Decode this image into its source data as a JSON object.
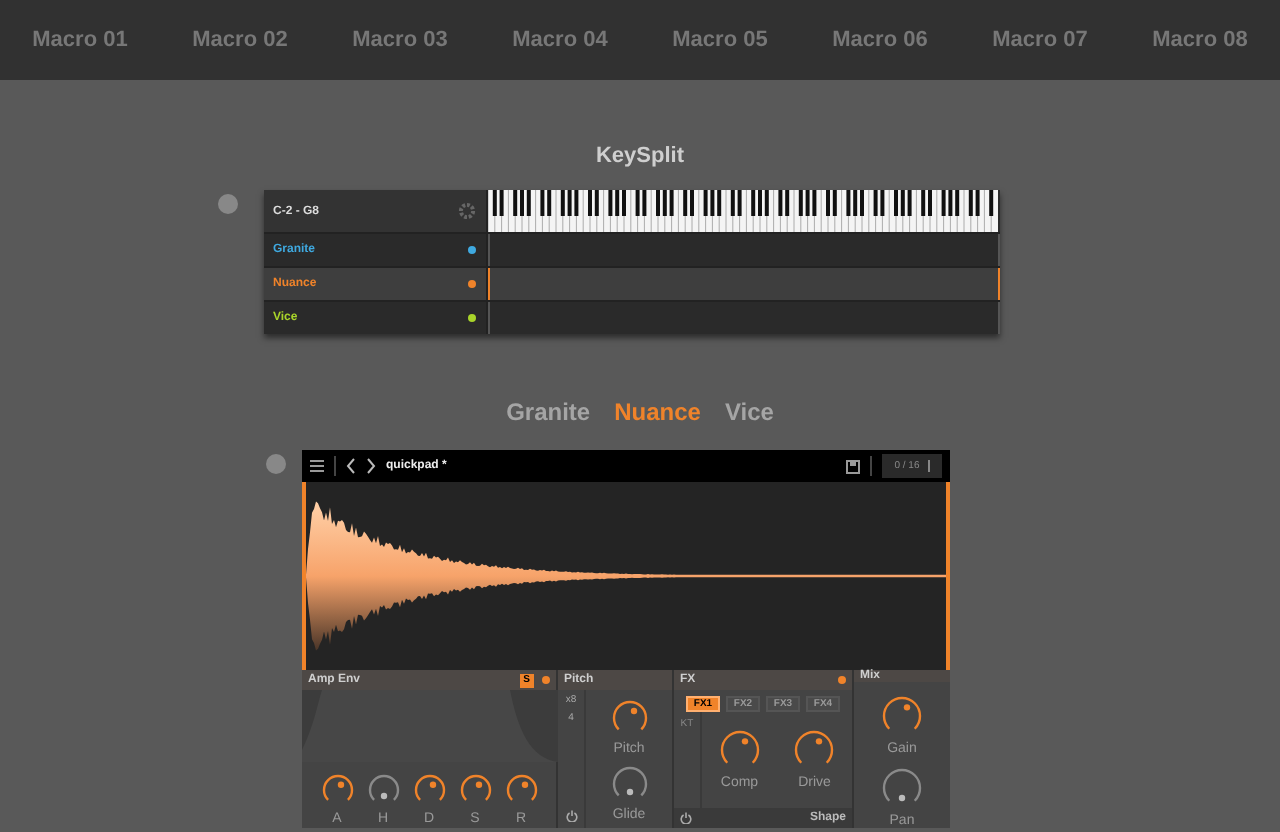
{
  "macros": [
    {
      "label": "Macro 01"
    },
    {
      "label": "Macro 02"
    },
    {
      "label": "Macro 03"
    },
    {
      "label": "Macro 04"
    },
    {
      "label": "Macro 05"
    },
    {
      "label": "Macro 06"
    },
    {
      "label": "Macro 07"
    },
    {
      "label": "Macro 08"
    }
  ],
  "keysplit": {
    "title": "KeySplit",
    "range": "C-2 - G8",
    "layers": [
      {
        "name": "Granite",
        "color": "#3fa9e0",
        "selected": false
      },
      {
        "name": "Nuance",
        "color": "#f0832a",
        "selected": true
      },
      {
        "name": "Vice",
        "color": "#a8d42a",
        "selected": false
      }
    ]
  },
  "layer_tabs": [
    {
      "label": "Granite",
      "selected": false
    },
    {
      "label": "Nuance",
      "selected": true
    },
    {
      "label": "Vice",
      "selected": false
    }
  ],
  "instrument": {
    "preset": "quickpad *",
    "counter": "0 / 16",
    "amp_env": {
      "title": "Amp Env",
      "badge": "S",
      "knobs": [
        {
          "label": "A",
          "on": true
        },
        {
          "label": "H",
          "on": false
        },
        {
          "label": "D",
          "on": true
        },
        {
          "label": "S",
          "on": true
        },
        {
          "label": "R",
          "on": true
        }
      ]
    },
    "pitch": {
      "title": "Pitch",
      "octave": "x8",
      "step": "4",
      "knobs": [
        {
          "label": "Pitch",
          "on": true
        },
        {
          "label": "Glide",
          "on": false
        }
      ]
    },
    "fx": {
      "title": "FX",
      "tabs": [
        {
          "label": "FX1",
          "selected": true
        },
        {
          "label": "FX2",
          "selected": false
        },
        {
          "label": "FX3",
          "selected": false
        },
        {
          "label": "FX4",
          "selected": false
        }
      ],
      "side_label": "KT",
      "knobs": [
        {
          "label": "Comp",
          "on": true
        },
        {
          "label": "Drive",
          "on": true
        }
      ],
      "footer": "Shape"
    },
    "mix": {
      "title": "Mix",
      "knobs": [
        {
          "label": "Gain",
          "on": true
        },
        {
          "label": "Pan",
          "on": false
        }
      ]
    }
  }
}
